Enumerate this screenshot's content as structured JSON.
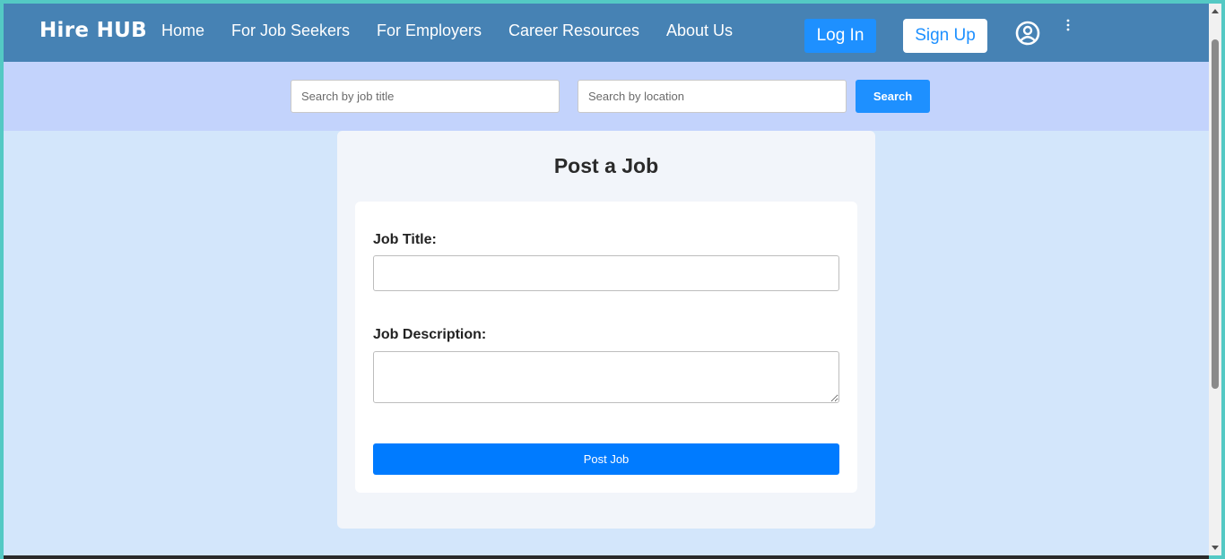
{
  "brand": {
    "name": "Hire HUB"
  },
  "nav": {
    "links": [
      "Home",
      "For Job Seekers",
      "For Employers",
      "Career Resources",
      "About Us"
    ],
    "login_label": "Log In",
    "signup_label": "Sign Up",
    "user_icon": "user-circle-icon",
    "menu_icon": "kebab-menu-icon"
  },
  "search": {
    "title_placeholder": "Search by job title",
    "location_placeholder": "Search by location",
    "button_label": "Search"
  },
  "post_job": {
    "heading": "Post a Job",
    "job_title_label": "Job Title:",
    "job_title_value": "",
    "job_description_label": "Job Description:",
    "job_description_value": "",
    "submit_label": "Post Job"
  },
  "colors": {
    "navbar": "#4682b4",
    "search_band": "#c3d3fc",
    "page_bg": "#d3e6fb",
    "accent": "#1e90ff",
    "submit": "#007bff"
  }
}
